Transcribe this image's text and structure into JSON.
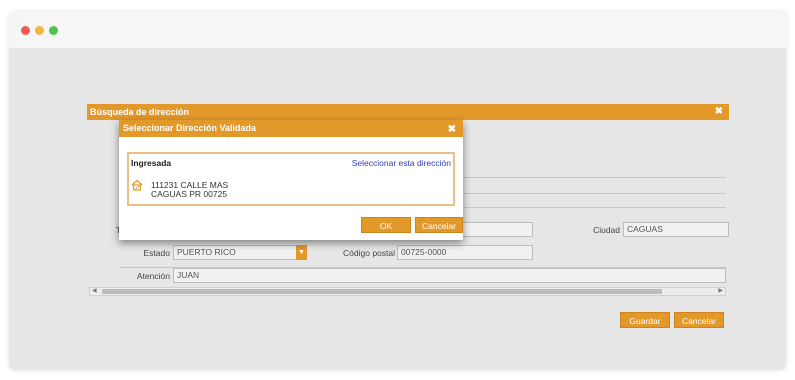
{
  "window": {
    "controls": [
      "close",
      "minimize",
      "maximize"
    ]
  },
  "outer_dialog": {
    "title": "Búsqueda de dirección",
    "close_label": "✖",
    "fields": {
      "ciudad_label": "Ciudad",
      "ciudad_value": "CAGUAS",
      "estado_label": "Estado",
      "estado_value": "PUERTO RICO",
      "codigo_postal_label": "Código postal",
      "codigo_postal_value": "00725-0000",
      "atencion_label": "Atención",
      "atencion_value": "JUAN",
      "partial_label": "T"
    },
    "save_label": "Guardar",
    "cancel_label": "Cancelar"
  },
  "inner_modal": {
    "title": "Seleccionar Dirección Validada",
    "close_label": "✖",
    "entered_heading": "Ingresada",
    "select_link": "Seleccionar esta dirección",
    "address_line1": "111231 CALLE MAS",
    "address_line2": "CAGUAS PR 00725",
    "ok_label": "OK",
    "cancel_label": "Cancelar"
  },
  "colors": {
    "accent": "#e3982a",
    "link": "#2b3fb3"
  },
  "icons": {
    "address": "home-pencil-icon",
    "dropdown": "chevron-down-icon"
  }
}
